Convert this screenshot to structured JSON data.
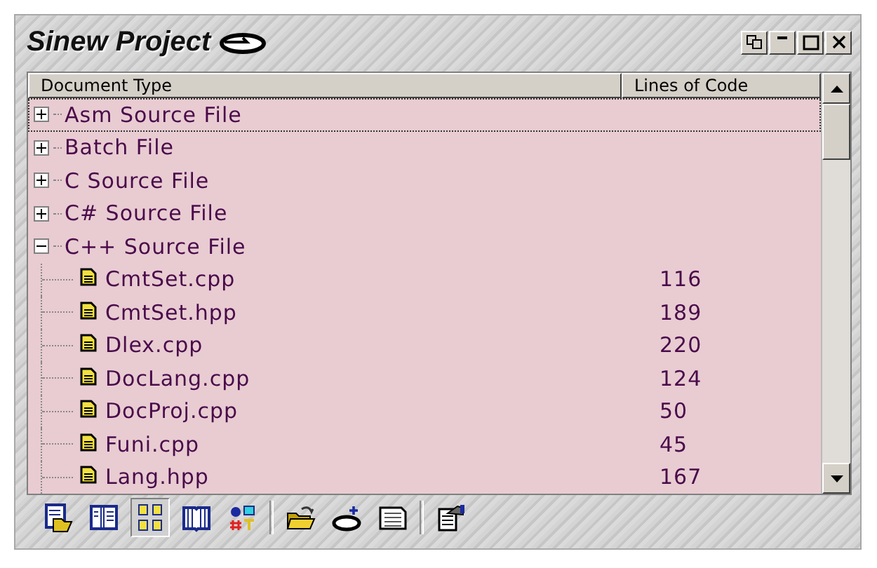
{
  "window": {
    "title": "Sinew Project"
  },
  "columns": [
    "Document Type",
    "Lines of Code"
  ],
  "tree": [
    {
      "label": "Asm Source File",
      "expanded": false,
      "focused": true
    },
    {
      "label": "Batch File",
      "expanded": false,
      "focused": false
    },
    {
      "label": "C Source File",
      "expanded": false,
      "focused": false
    },
    {
      "label": "C# Source File",
      "expanded": false,
      "focused": false
    },
    {
      "label": "C++ Source File",
      "expanded": true,
      "focused": false,
      "children": [
        {
          "label": "CmtSet.cpp",
          "lines": "116"
        },
        {
          "label": "CmtSet.hpp",
          "lines": "189"
        },
        {
          "label": "Dlex.cpp",
          "lines": "220"
        },
        {
          "label": "DocLang.cpp",
          "lines": "124"
        },
        {
          "label": "DocProj.cpp",
          "lines": "50"
        },
        {
          "label": "Funi.cpp",
          "lines": "45"
        },
        {
          "label": "Lang.hpp",
          "lines": "167"
        }
      ]
    }
  ],
  "toolbar": [
    {
      "kind": "open-doc",
      "pressed": false
    },
    {
      "kind": "columns",
      "pressed": false
    },
    {
      "kind": "grid",
      "pressed": true
    },
    {
      "kind": "book",
      "pressed": false
    },
    {
      "kind": "symbols",
      "pressed": false
    },
    {
      "kind": "sep"
    },
    {
      "kind": "folder",
      "pressed": false
    },
    {
      "kind": "add-project",
      "pressed": false
    },
    {
      "kind": "list",
      "pressed": false
    },
    {
      "kind": "sep"
    },
    {
      "kind": "properties",
      "pressed": false
    }
  ]
}
